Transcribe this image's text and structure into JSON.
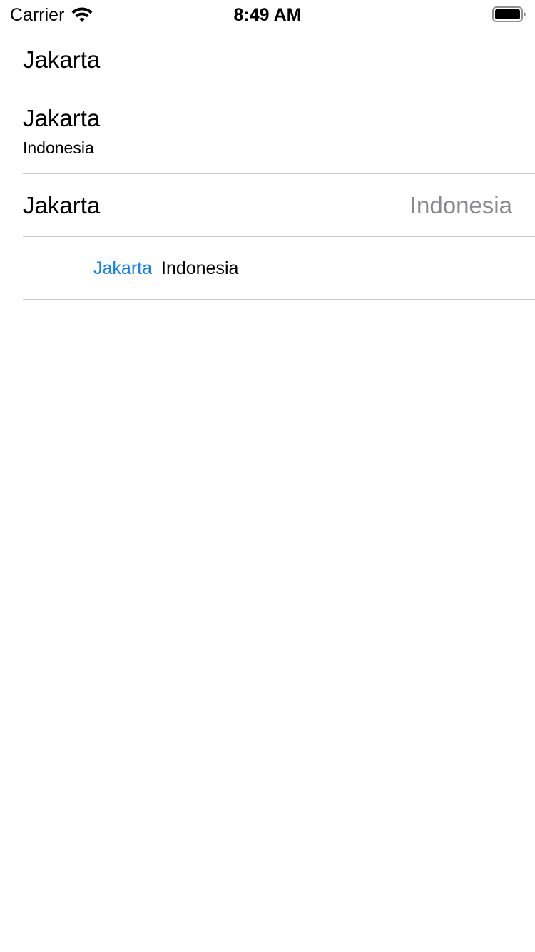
{
  "status_bar": {
    "carrier": "Carrier",
    "time": "8:49 AM",
    "wifi_icon": "wifi-icon",
    "battery_icon": "battery-full-icon"
  },
  "cells": {
    "default": {
      "title": "Jakarta"
    },
    "subtitle": {
      "title": "Jakarta",
      "subtitle": "Indonesia"
    },
    "value1": {
      "title": "Jakarta",
      "detail": "Indonesia"
    },
    "value2": {
      "label": "Jakarta",
      "detail": "Indonesia"
    }
  },
  "colors": {
    "accent": "#147efb",
    "secondary_text": "#8a8a8e",
    "separator": "#c8c7cc"
  }
}
